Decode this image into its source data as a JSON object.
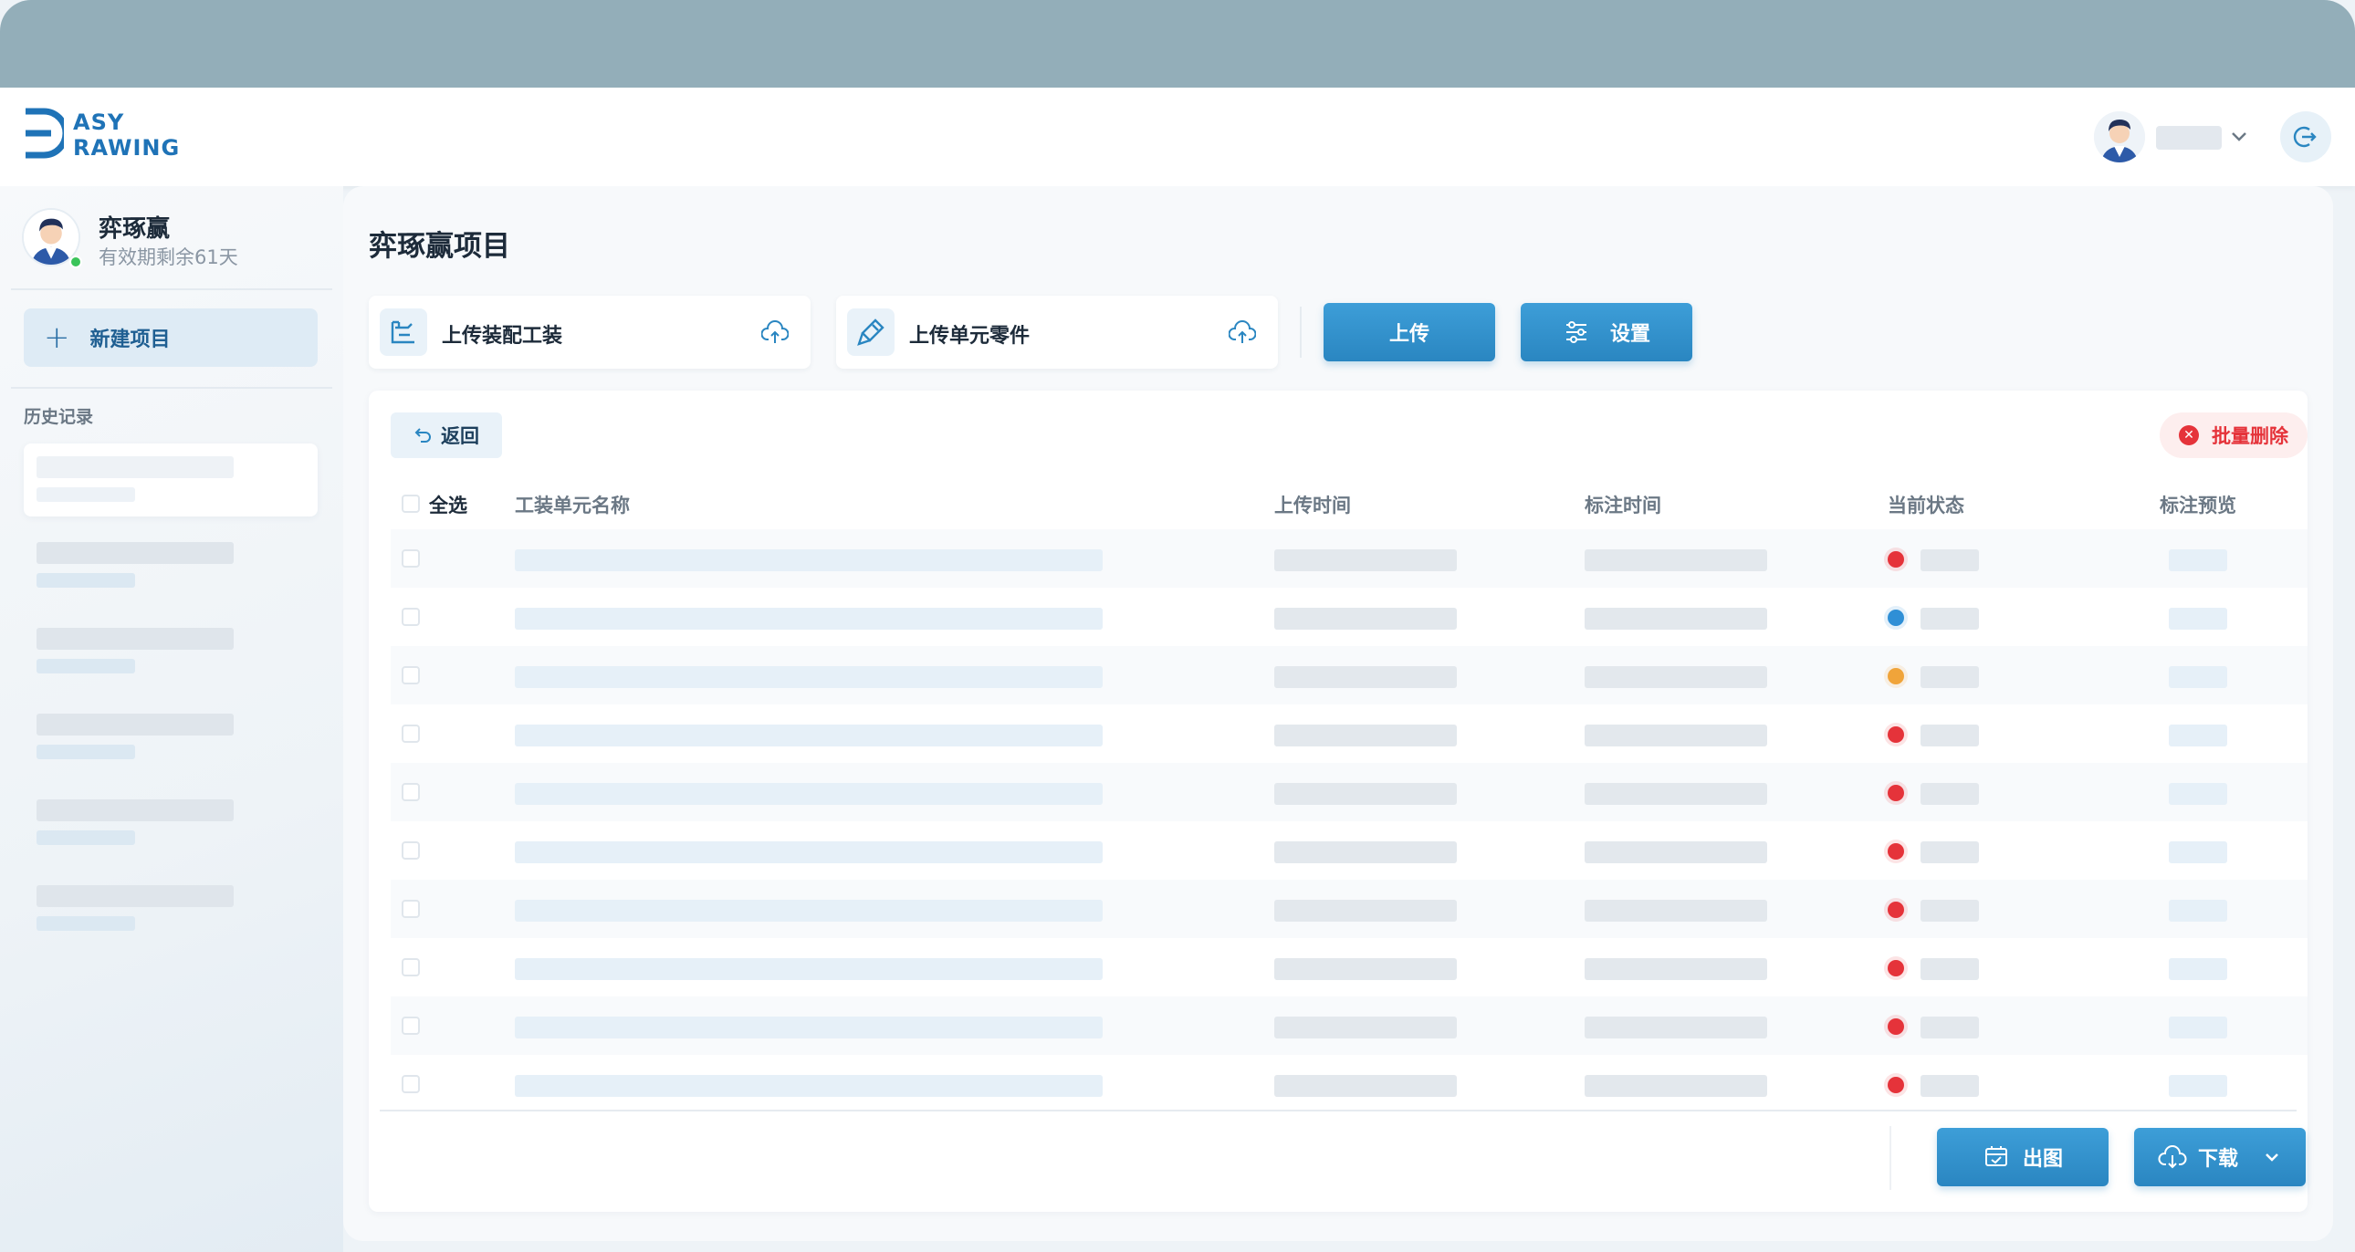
{
  "header": {
    "logo_line1": "ASY",
    "logo_line2": "RAWING",
    "logout_icon": "logout-icon"
  },
  "sidebar": {
    "username": "弈琢赢",
    "validity": "有效期剩余61天",
    "new_project_label": "新建项目",
    "history_label": "历史记录"
  },
  "main": {
    "title": "弈琢赢项目",
    "upload_assembly_label": "上传装配工装",
    "upload_part_label": "上传单元零件",
    "upload_button": "上传",
    "settings_button": "设置",
    "back_button": "返回",
    "batch_delete_button": "批量删除",
    "columns": {
      "select_all": "全选",
      "name": "工装单元名称",
      "upload_time": "上传时间",
      "annotate_time": "标注时间",
      "status": "当前状态",
      "preview": "标注预览"
    },
    "row_status_colors": [
      "#e5333a",
      "#2f8fd6",
      "#f0a43a",
      "#e5333a",
      "#e5333a",
      "#e5333a",
      "#e5333a",
      "#e5333a",
      "#e5333a",
      "#e5333a"
    ],
    "export_button": "出图",
    "download_button": "下载"
  }
}
